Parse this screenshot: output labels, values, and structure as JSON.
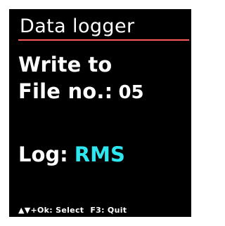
{
  "screen": {
    "title": "Data logger",
    "write_to_label": "Write to",
    "file_label": "File no.:",
    "file_number": "05",
    "log_label": "Log:",
    "log_value": "RMS",
    "hint_navigation": "▲▼+Ok: Select",
    "hint_quit": "F3: Quit"
  },
  "colors": {
    "background": "#000000",
    "title_text": "#ffffff",
    "title_rule": "#ff5a5a",
    "primary_text": "#ffffff",
    "accent_text": "#2ee6ef"
  }
}
